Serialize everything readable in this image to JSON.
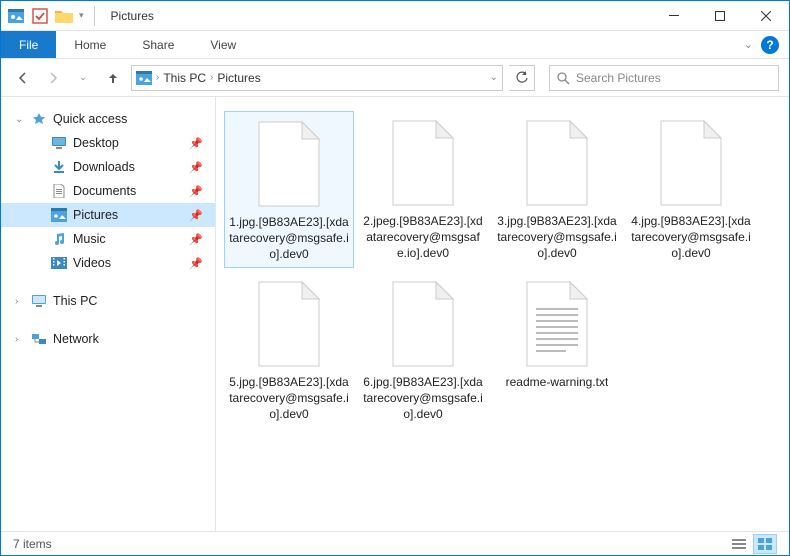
{
  "titlebar": {
    "title": "Pictures"
  },
  "ribbon": {
    "file": "File",
    "tabs": [
      "Home",
      "Share",
      "View"
    ]
  },
  "breadcrumb": {
    "root": "This PC",
    "current": "Pictures"
  },
  "search": {
    "placeholder": "Search Pictures"
  },
  "sidebar": {
    "quick_access": "Quick access",
    "items": [
      {
        "label": "Desktop",
        "icon": "desktop"
      },
      {
        "label": "Downloads",
        "icon": "downloads"
      },
      {
        "label": "Documents",
        "icon": "documents"
      },
      {
        "label": "Pictures",
        "icon": "pictures",
        "selected": true
      },
      {
        "label": "Music",
        "icon": "music"
      },
      {
        "label": "Videos",
        "icon": "videos"
      }
    ],
    "this_pc": "This PC",
    "network": "Network"
  },
  "files": [
    {
      "name": "1.jpg.[9B83AE23].[xdatarecovery@msgsafe.io].dev0",
      "type": "blank",
      "selected": true
    },
    {
      "name": "2.jpeg.[9B83AE23].[xdatarecovery@msgsafe.io].dev0",
      "type": "blank"
    },
    {
      "name": "3.jpg.[9B83AE23].[xdatarecovery@msgsafe.io].dev0",
      "type": "blank"
    },
    {
      "name": "4.jpg.[9B83AE23].[xdatarecovery@msgsafe.io].dev0",
      "type": "blank"
    },
    {
      "name": "5.jpg.[9B83AE23].[xdatarecovery@msgsafe.io].dev0",
      "type": "blank"
    },
    {
      "name": "6.jpg.[9B83AE23].[xdatarecovery@msgsafe.io].dev0",
      "type": "blank"
    },
    {
      "name": "readme-warning.txt",
      "type": "text"
    }
  ],
  "status": {
    "count": "7 items"
  }
}
